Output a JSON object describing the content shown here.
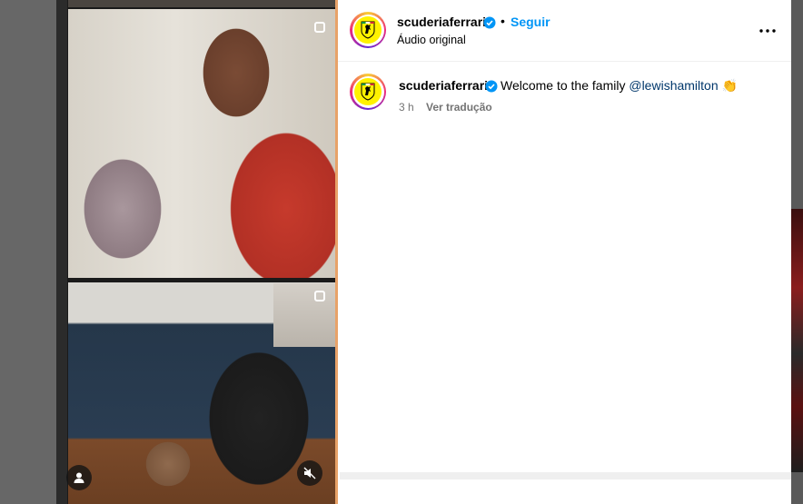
{
  "post": {
    "account": "scuderiaferrari",
    "separator": "•",
    "follow_label": "Seguir",
    "audio_label": "Áudio original",
    "caption_user": "scuderiaferrari",
    "caption_text": "Welcome to the family",
    "caption_mention": "@lewishamilton",
    "caption_emoji": "👏",
    "time_ago": "3 h",
    "translate_label": "Ver tradução"
  },
  "icons": {
    "verified": "verified-badge-icon",
    "more": "more-options-icon",
    "reel": "reel-icon",
    "carousel": "carousel-icon",
    "profile": "user-icon",
    "mute": "muted-speaker-icon"
  },
  "colors": {
    "link_blue": "#0095f6",
    "mention": "#00376b",
    "verified_blue": "#0095f6",
    "ferrari_yellow": "#fff200",
    "muted_text": "#737373"
  }
}
